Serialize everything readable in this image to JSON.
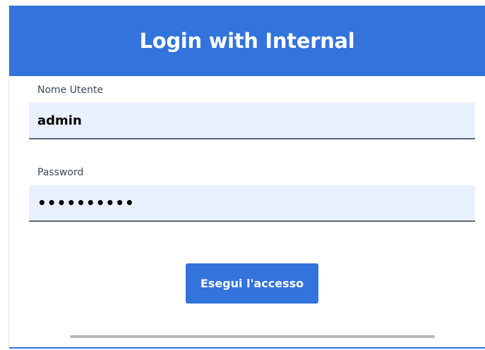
{
  "header": {
    "title": "Login with Internal"
  },
  "form": {
    "username": {
      "label": "Nome Utente",
      "value": "admin"
    },
    "password": {
      "label": "Password",
      "value": "••••••••••"
    },
    "submit_label": "Esegui l'accesso"
  },
  "colors": {
    "primary": "#3273dc",
    "input_background": "#e8f0fe",
    "label_text": "#3c4a5a"
  }
}
